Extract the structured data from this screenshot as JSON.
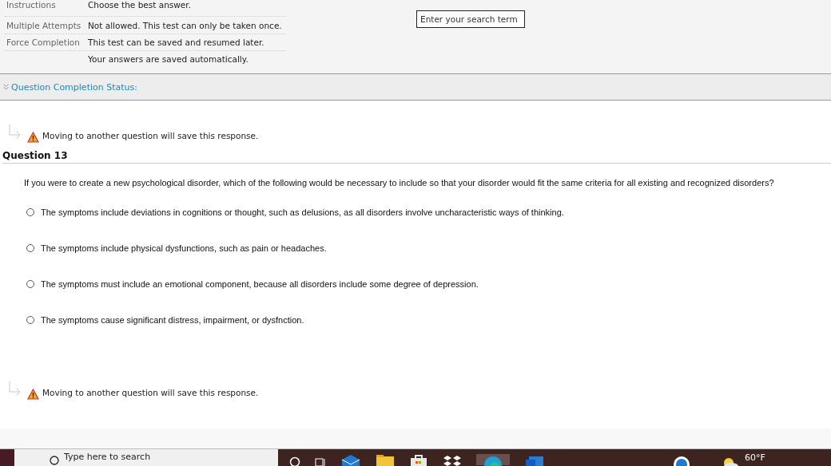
{
  "test_info": [
    {
      "label": "Instructions",
      "value": "Choose the best answer."
    },
    {
      "label": "Multiple Attempts",
      "value": "Not allowed. This test can only be taken once."
    },
    {
      "label": "Force Completion",
      "value": "This test can be saved and resumed later."
    },
    {
      "value": "Your answers are saved automatically."
    }
  ],
  "search": {
    "placeholder": "Enter your search term"
  },
  "completion_status": {
    "label": "Question Completion Status:",
    "expanded": false
  },
  "save_notice_top": "Moving to another question will save this response.",
  "question": {
    "title": "Question 13",
    "text": "If you were to create a new psychological disorder, which of the following would be necessary to include so that your disorder would fit the same criteria for all existing and recognized disorders?",
    "options": [
      {
        "label": "The symptoms include deviations in cognitions or thought, such as delusions, as all disorders involve uncharacteristic ways of thinking.",
        "selected": false
      },
      {
        "label": "The symptoms include physical dysfunctions, such as pain or headaches.",
        "selected": false
      },
      {
        "label": "The symptoms must include an emotional component, because all disorders include some degree of depression.",
        "selected": false
      },
      {
        "label": "The symptoms cause significant distress, impairment, or dysfnction.",
        "selected": false
      }
    ]
  },
  "save_notice_bottom": "Moving to another question will save this response.",
  "taskbar": {
    "search_placeholder": "Type here to search",
    "weather": "60°F"
  }
}
